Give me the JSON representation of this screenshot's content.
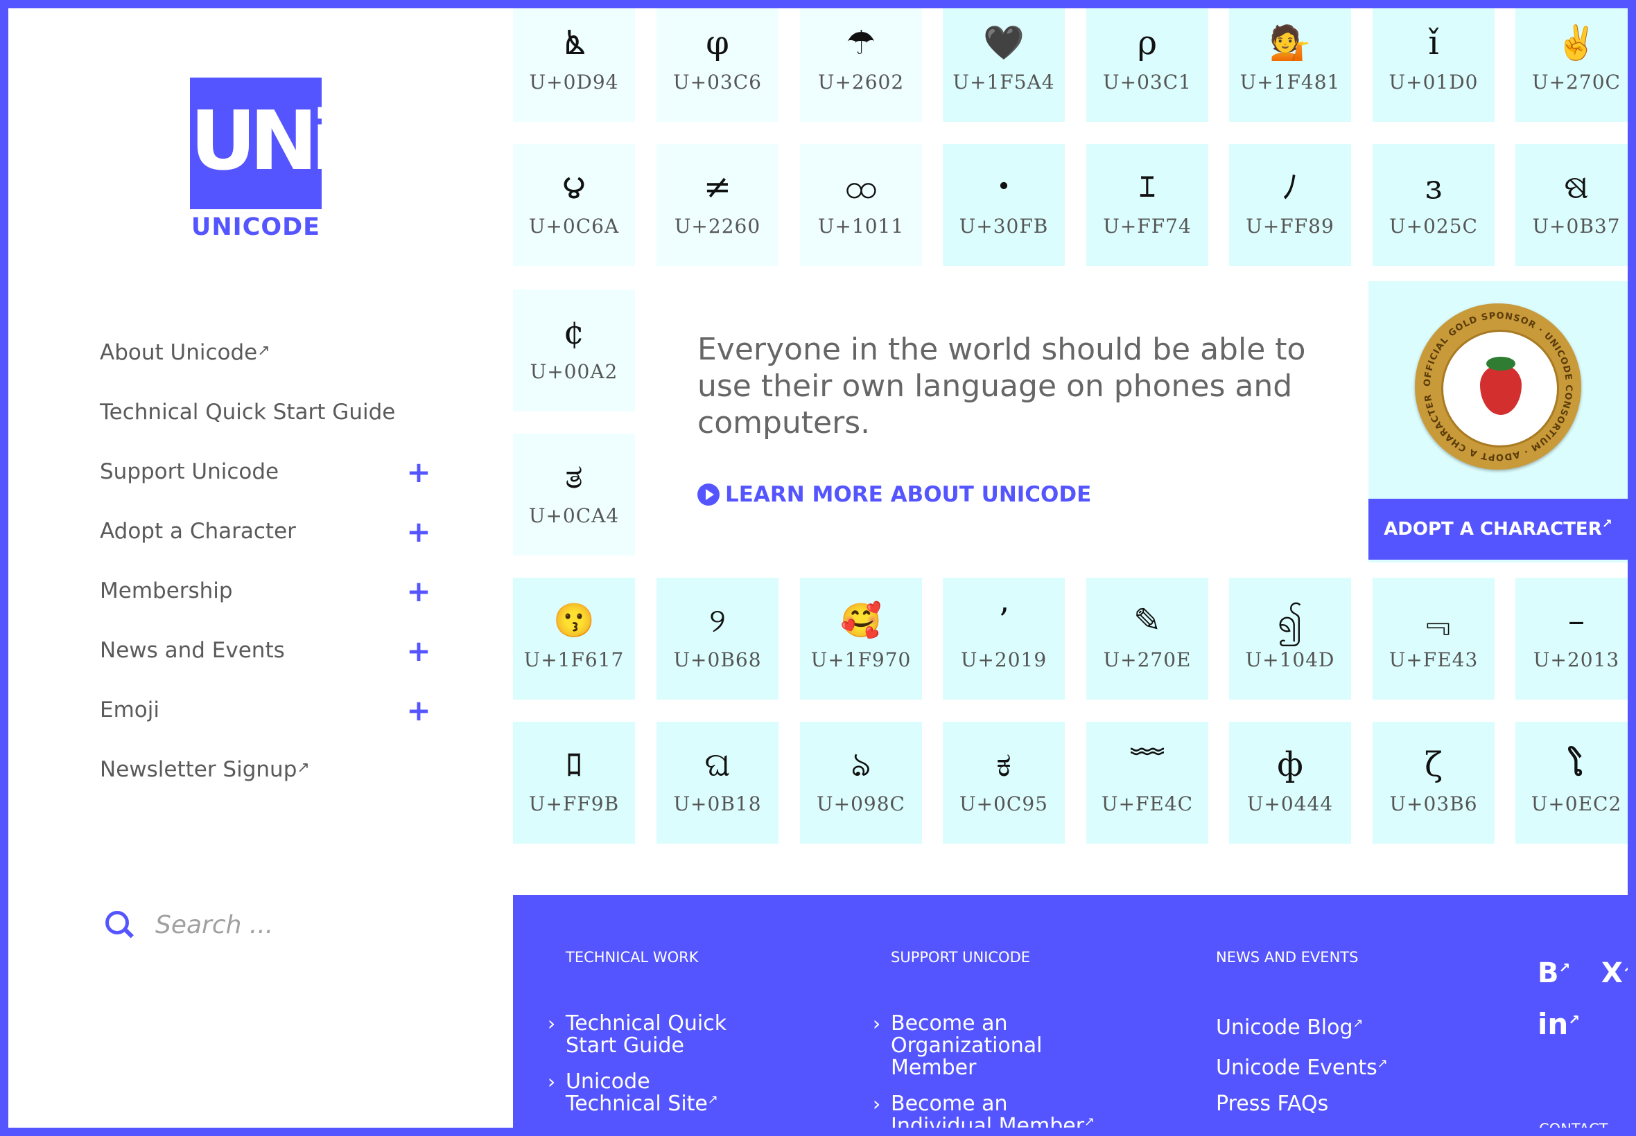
{
  "logo": {
    "mark": "UNi",
    "word": "UNICODE"
  },
  "sidebar": {
    "items": [
      {
        "label": "About Unicode",
        "external": true,
        "expandable": false
      },
      {
        "label": "Technical Quick Start Guide",
        "external": false,
        "expandable": false
      },
      {
        "label": "Support Unicode",
        "external": false,
        "expandable": true
      },
      {
        "label": "Adopt a Character",
        "external": false,
        "expandable": true
      },
      {
        "label": "Membership",
        "external": false,
        "expandable": true
      },
      {
        "label": "News and Events",
        "external": false,
        "expandable": true
      },
      {
        "label": "Emoji",
        "external": false,
        "expandable": true
      },
      {
        "label": "Newsletter Signup",
        "external": true,
        "expandable": false
      }
    ],
    "plus_symbol": "+",
    "ext_symbol": "↗"
  },
  "search": {
    "placeholder": "Search ..."
  },
  "tiles": {
    "row1": [
      {
        "glyph": "ൔ",
        "code": "U+0D94"
      },
      {
        "glyph": "φ",
        "code": "U+03C6"
      },
      {
        "glyph": "☂",
        "code": "U+2602"
      },
      {
        "glyph": "🖤",
        "code": "U+1F5A4"
      },
      {
        "glyph": "ρ",
        "code": "U+03C1"
      },
      {
        "glyph": "💁",
        "code": "U+1F481"
      },
      {
        "glyph": "ǐ",
        "code": "U+01D0"
      },
      {
        "glyph": "✌",
        "code": "U+270C"
      }
    ],
    "row2": [
      {
        "glyph": "౪",
        "code": "U+0C6A"
      },
      {
        "glyph": "≠",
        "code": "U+2260"
      },
      {
        "glyph": "ထ",
        "code": "U+1011"
      },
      {
        "glyph": "・",
        "code": "U+30FB"
      },
      {
        "glyph": "ｴ",
        "code": "U+FF74"
      },
      {
        "glyph": "ﾉ",
        "code": "U+FF89"
      },
      {
        "glyph": "ɜ",
        "code": "U+025C"
      },
      {
        "glyph": "ଷ",
        "code": "U+0B37"
      }
    ],
    "side": [
      {
        "glyph": "¢",
        "code": "U+00A2"
      },
      {
        "glyph": "ತ",
        "code": "U+0CA4"
      }
    ],
    "row3": [
      {
        "glyph": "😗",
        "code": "U+1F617"
      },
      {
        "glyph": "୨",
        "code": "U+0B68"
      },
      {
        "glyph": "🥰",
        "code": "U+1F970"
      },
      {
        "glyph": "’",
        "code": "U+2019"
      },
      {
        "glyph": "✎",
        "code": "U+270E"
      },
      {
        "glyph": "၍",
        "code": "U+104D"
      },
      {
        "glyph": "﹃",
        "code": "U+FE43"
      },
      {
        "glyph": "–",
        "code": "U+2013"
      }
    ],
    "row4": [
      {
        "glyph": "ﾛ",
        "code": "U+FF9B"
      },
      {
        "glyph": "ଘ",
        "code": "U+0B18"
      },
      {
        "glyph": "ঌ",
        "code": "U+098C"
      },
      {
        "glyph": "ಕ",
        "code": "U+0C95"
      },
      {
        "glyph": "﹌",
        "code": "U+FE4C"
      },
      {
        "glyph": "ф",
        "code": "U+0444"
      },
      {
        "glyph": "ζ",
        "code": "U+03B6"
      },
      {
        "glyph": "ໂ",
        "code": "U+0EC2"
      }
    ]
  },
  "mission": {
    "text": "Everyone in the world should be able to use their own language on phones and computers.",
    "learn_more": "LEARN MORE ABOUT UNICODE"
  },
  "adopt": {
    "badge_text": "OFFICIAL GOLD SPONSOR · UNICODE CONSORTIUM · ADOPT A CHARACTER",
    "button_label": "ADOPT A CHARACTER",
    "ext_symbol": "↗"
  },
  "footer": {
    "technical": {
      "title": "TECHNICAL WORK",
      "links": [
        {
          "label": "Technical Quick Start Guide",
          "external": false
        },
        {
          "label": "Unicode Technical Site",
          "external": true
        }
      ]
    },
    "support": {
      "title": "SUPPORT UNICODE",
      "links": [
        {
          "label": "Become an Organizational Member",
          "external": false
        },
        {
          "label": "Become an Individual Member",
          "external": true
        }
      ]
    },
    "news": {
      "title": "NEWS AND EVENTS",
      "links": [
        {
          "label": "Unicode Blog",
          "external": true
        },
        {
          "label": "Unicode Events",
          "external": true
        },
        {
          "label": "Press FAQs",
          "external": false
        }
      ]
    },
    "social": {
      "blogger": "B",
      "x": "X",
      "linkedin": "in"
    },
    "contact": "CONTACT",
    "chevron": "›",
    "ext_symbol": "↗"
  },
  "colors": {
    "brand": "#5555ff",
    "tile_bg_light": "#effefe",
    "tile_bg": "#dcfdfd",
    "nav_text": "#5a5a5a"
  }
}
